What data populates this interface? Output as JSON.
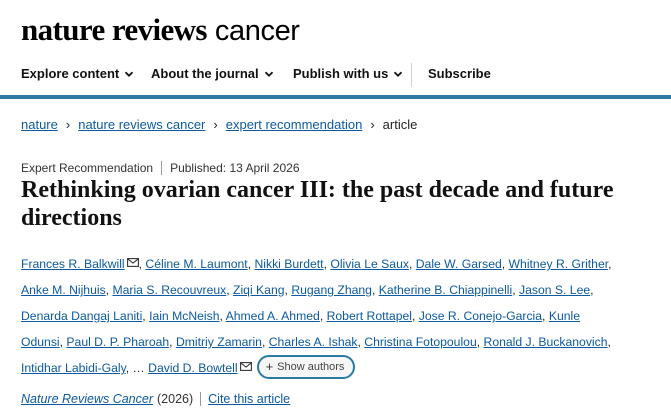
{
  "header": {
    "brand_bold": "nature reviews",
    "brand_light": "cancer",
    "nav": [
      {
        "label": "Explore content"
      },
      {
        "label": "About the journal"
      },
      {
        "label": "Publish with us"
      },
      {
        "label": "Subscribe"
      }
    ]
  },
  "breadcrumb": {
    "items": [
      "nature",
      "nature reviews cancer",
      "expert recommendation"
    ],
    "current": "article"
  },
  "article": {
    "type": "Expert Recommendation",
    "published": "Published: 13 April 2026",
    "title": "Rethinking ovarian cancer III: the past decade and future directions",
    "authors_lines": [
      [
        {
          "name": "Frances R. Balkwill",
          "mail": true,
          "sep": ", "
        },
        {
          "name": "Céline M. Laumont",
          "sep": ", "
        },
        {
          "name": "Nikki Burdett",
          "sep": ", "
        },
        {
          "name": "Olivia Le Saux",
          "sep": ", "
        },
        {
          "name": "Dale W. Garsed",
          "sep": ", "
        },
        {
          "name": "Whitney R. Grither",
          "sep": ","
        }
      ],
      [
        {
          "name": "Anke M. Nijhuis",
          "sep": ", "
        },
        {
          "name": "Maria S. Recouvreux",
          "sep": ", "
        },
        {
          "name": "Ziqi Kang",
          "sep": ", "
        },
        {
          "name": "Rugang Zhang",
          "sep": ", "
        },
        {
          "name": "Katherine B. Chiappinelli",
          "sep": ", "
        },
        {
          "name": "Jason S. Lee",
          "sep": ","
        }
      ],
      [
        {
          "name": "Denarda Dangaj Laniti",
          "sep": ", "
        },
        {
          "name": "Iain McNeish",
          "sep": ", "
        },
        {
          "name": "Ahmed A. Ahmed",
          "sep": ", "
        },
        {
          "name": "Robert Rottapel",
          "sep": ", "
        },
        {
          "name": "Jose R. Conejo-Garcia",
          "sep": ", "
        },
        {
          "name": "Kunle",
          "sep": ""
        }
      ],
      [
        {
          "name": "Odunsi",
          "sep": ", "
        },
        {
          "name": "Paul D. P. Pharoah",
          "sep": ", "
        },
        {
          "name": "Dmitriy Zamarin",
          "sep": ", "
        },
        {
          "name": "Charles A. Ishak",
          "sep": ", "
        },
        {
          "name": "Christina Fotopoulou",
          "sep": ", "
        },
        {
          "name": "Ronald J. Buckanovich",
          "sep": ","
        }
      ],
      [
        {
          "name": "Intidhar Labidi-Galy",
          "sep": ", … "
        },
        {
          "name": "David D. Bowtell",
          "mail": true,
          "sep": ""
        }
      ]
    ],
    "show_authors_label": "Show authors",
    "citation": {
      "journal": "Nature Reviews Cancer",
      "year": "(2026)",
      "cite_label": "Cite this article"
    }
  },
  "colors": {
    "accent": "#2a7aa1",
    "link": "#0d5aa0"
  }
}
